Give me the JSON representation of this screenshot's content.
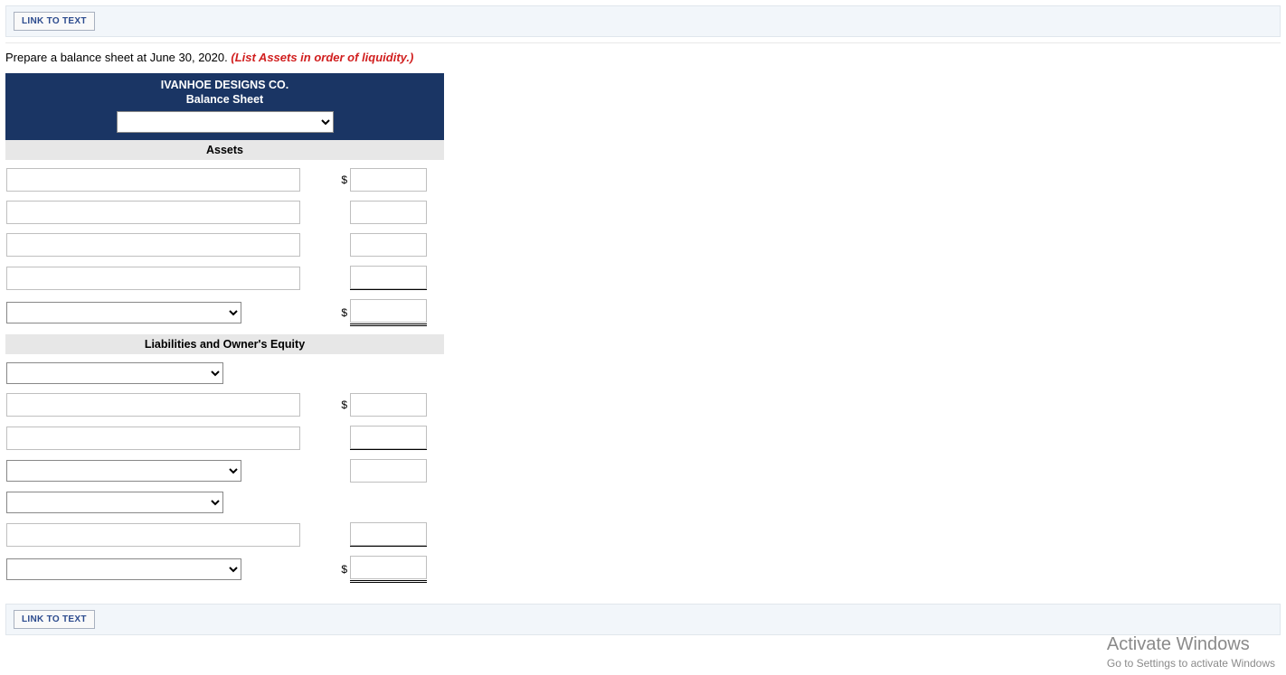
{
  "buttons": {
    "link_to_text": "LINK TO TEXT"
  },
  "instruction": {
    "text": "Prepare a balance sheet at June 30, 2020. ",
    "hint": "(List Assets in order of liquidity.)"
  },
  "sheet": {
    "company": "IVANHOE DESIGNS CO.",
    "statement": "Balance Sheet",
    "date_value": "",
    "sections": {
      "assets": {
        "heading": "Assets",
        "rows": [
          {
            "label": "",
            "amount": "",
            "currency": "$"
          },
          {
            "label": "",
            "amount": "",
            "currency": ""
          },
          {
            "label": "",
            "amount": "",
            "currency": ""
          },
          {
            "label": "",
            "amount": "",
            "currency": ""
          }
        ],
        "total": {
          "label": "",
          "amount": "",
          "currency": "$"
        }
      },
      "liabilities_equity": {
        "heading": "Liabilities and Owner's Equity",
        "subheading1": "",
        "rows1": [
          {
            "label": "",
            "amount": "",
            "currency": "$"
          },
          {
            "label": "",
            "amount": "",
            "currency": ""
          }
        ],
        "subtotal1": {
          "label": "",
          "amount": "",
          "currency": ""
        },
        "subheading2": "",
        "rows2": [
          {
            "label": "",
            "amount": "",
            "currency": ""
          }
        ],
        "total": {
          "label": "",
          "amount": "",
          "currency": "$"
        }
      }
    }
  },
  "watermark": {
    "line1": "Activate Windows",
    "line2": "Go to Settings to activate Windows"
  }
}
